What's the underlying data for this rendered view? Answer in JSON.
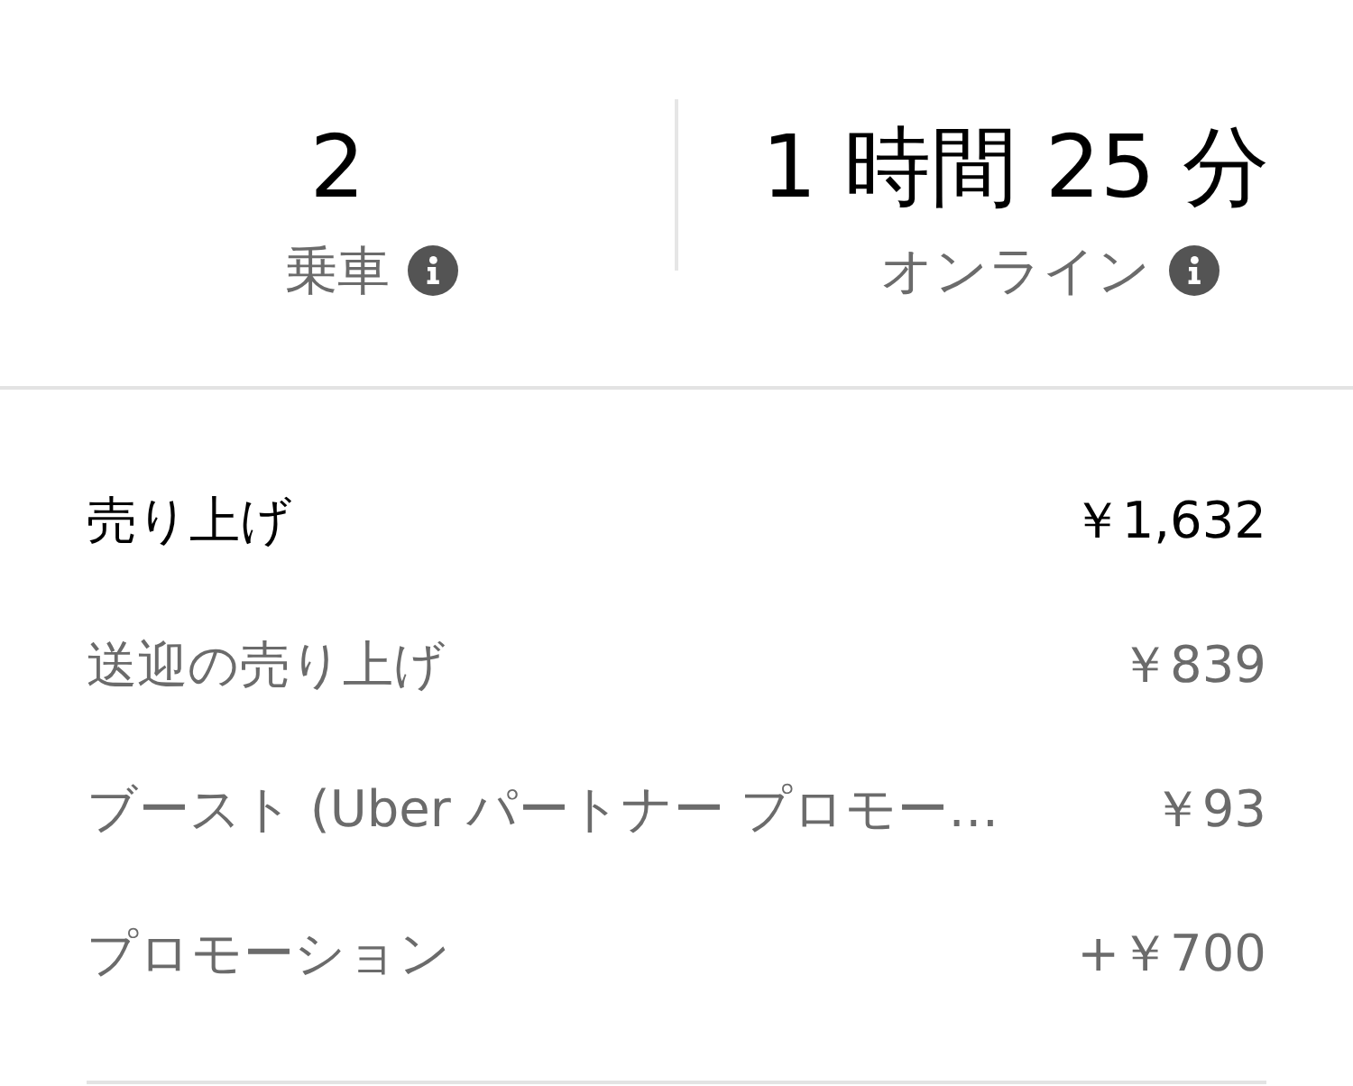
{
  "stats": [
    {
      "value": "2",
      "label": "乗車"
    },
    {
      "value": "1 時間 25 分",
      "label": "オンライン"
    }
  ],
  "earnings": [
    {
      "kind": "total",
      "label": "売り上げ",
      "amount": "￥1,632"
    },
    {
      "kind": "item",
      "label": "送迎の売り上げ",
      "amount": "￥839"
    },
    {
      "kind": "item",
      "label": "ブースト (Uber パートナー プロモー…",
      "amount": "￥93"
    },
    {
      "kind": "item",
      "label": "プロモーション",
      "amount": "+￥700"
    }
  ]
}
